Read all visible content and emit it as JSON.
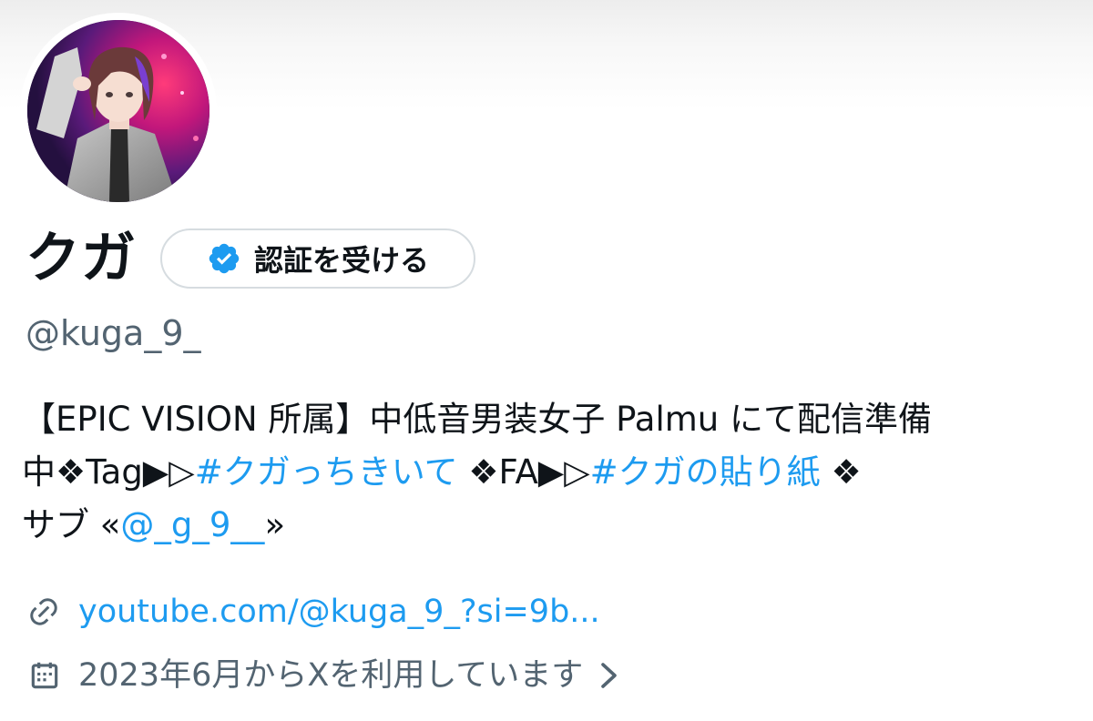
{
  "profile": {
    "display_name": "クガ",
    "handle": "@kuga_9_",
    "verify_button_label": "認証を受ける",
    "bio": {
      "line1": "【EPIC VISION 所属】中低音男装女子 Palmu にて配信準備",
      "line2_prefix": "中❖Tag▶▷",
      "hashtag_1": "#クガっちきいて",
      "line2_mid": " ❖FA▶▷",
      "hashtag_2": "#クガの貼り紙",
      "line2_suffix": " ❖",
      "line3_prefix": "サブ «",
      "mention": "@_g_9__",
      "line3_suffix": "»"
    },
    "website": "youtube.com/@kuga_9_?si=9b...",
    "joined": "2023年6月からXを利用しています"
  },
  "icons": {
    "avatar": "avatar-image",
    "verified": "verified-badge-icon",
    "link": "link-icon",
    "calendar": "calendar-icon",
    "chevron": "chevron-right-icon"
  },
  "colors": {
    "accent": "#1d9bf0",
    "text": "#0f1419",
    "secondary": "#536471",
    "border": "#d6dce0"
  }
}
